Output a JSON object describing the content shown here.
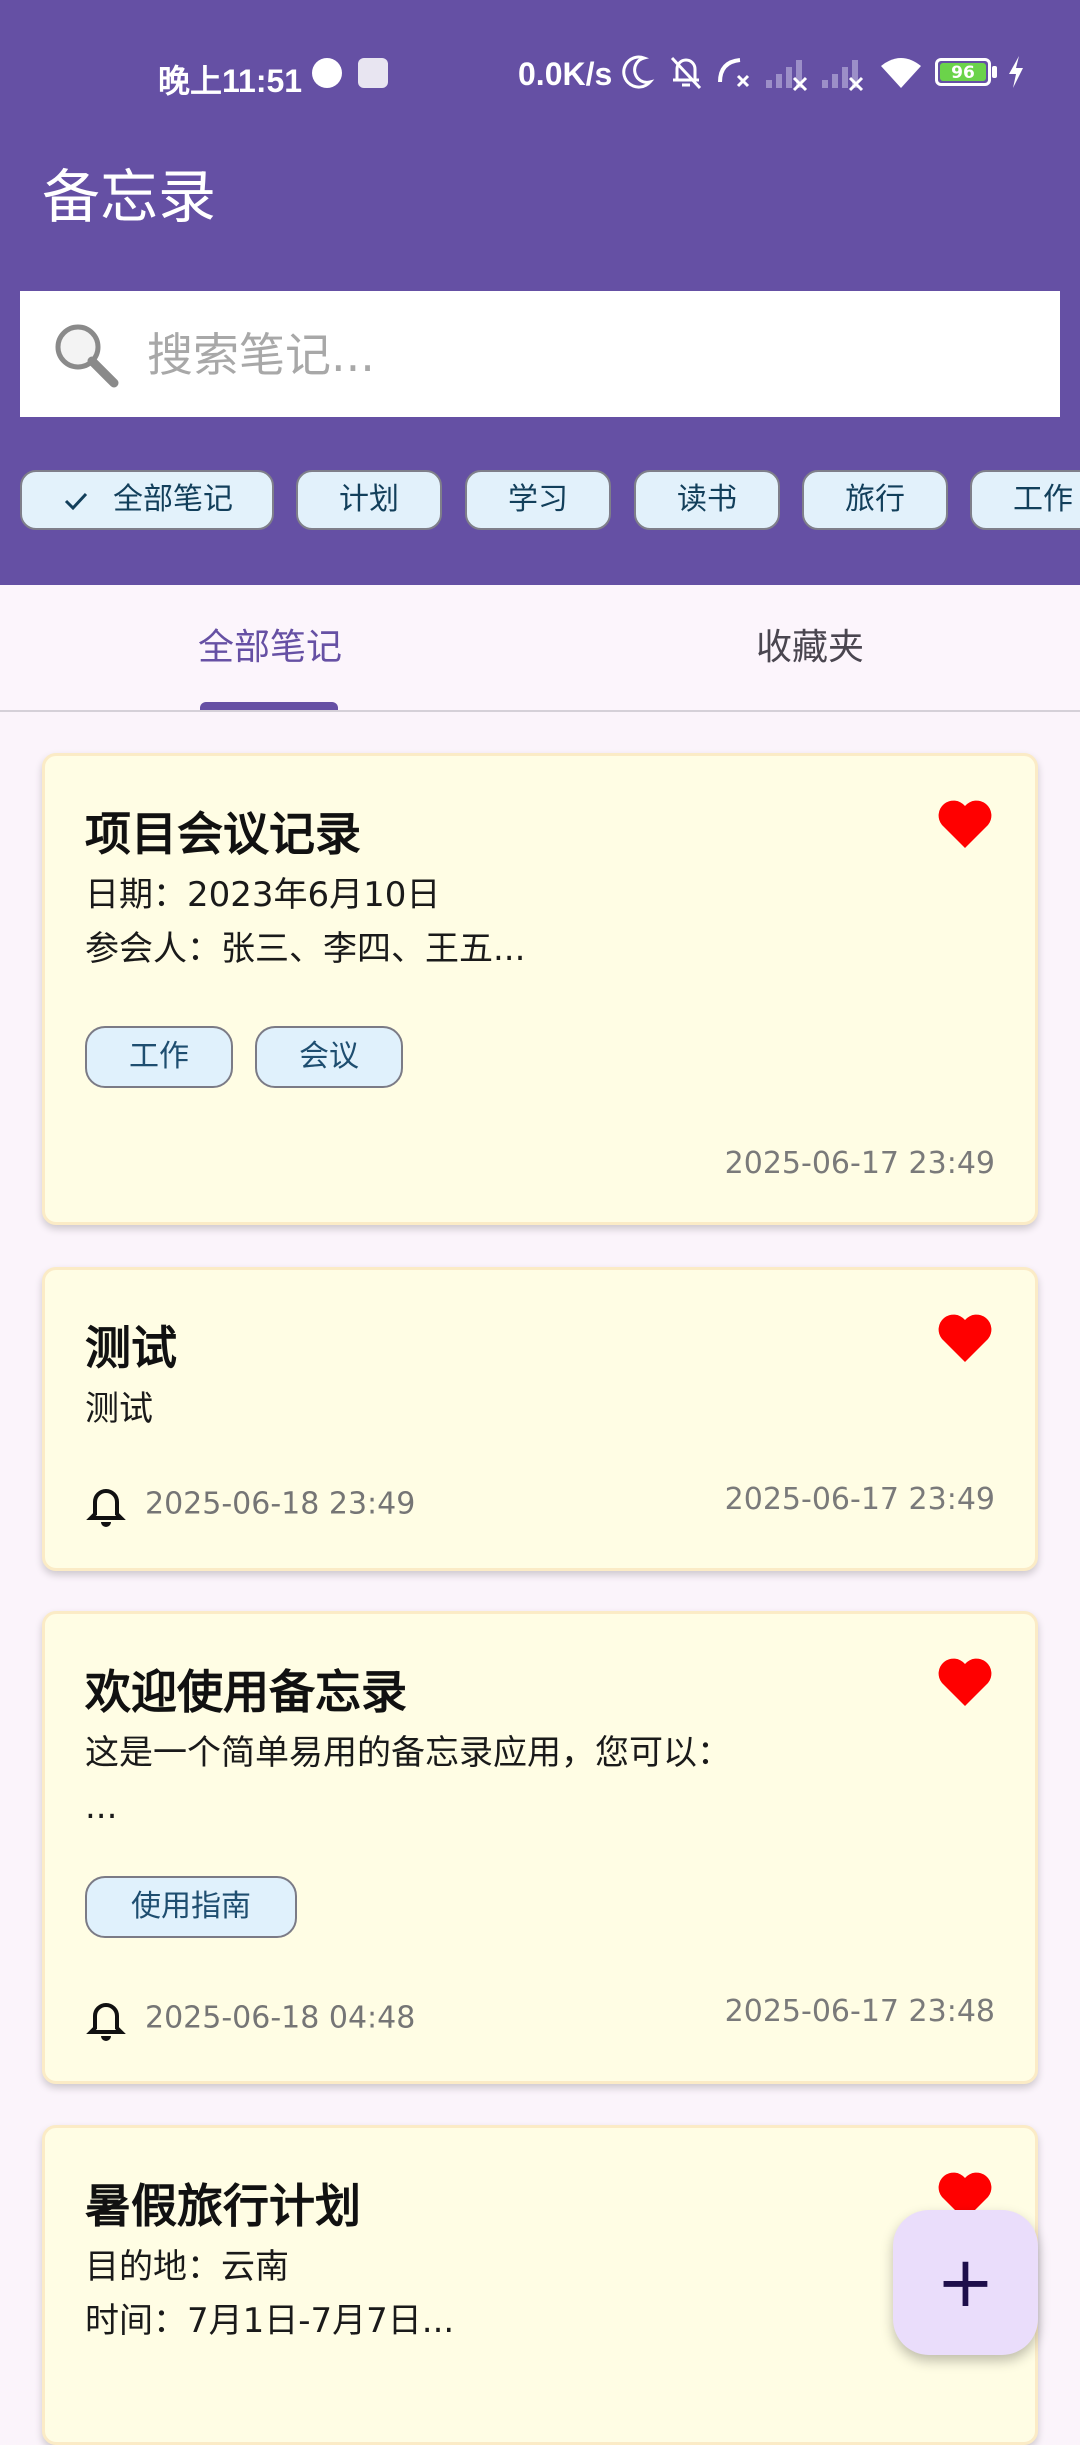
{
  "status_bar": {
    "time": "晚上11:51",
    "net_speed": "0.0K/s",
    "battery": "96",
    "icons": [
      "app-badge-icon",
      "game-icon",
      "moon-icon",
      "bell-off-icon",
      "call-missed-icon",
      "signal-off-icon",
      "signal-off-icon",
      "wifi-icon",
      "battery-icon",
      "charging-icon"
    ]
  },
  "app": {
    "title": "备忘录"
  },
  "search": {
    "placeholder": "搜索笔记..."
  },
  "filters": {
    "chips": [
      {
        "label": "全部笔记",
        "selected": true
      },
      {
        "label": "计划",
        "selected": false
      },
      {
        "label": "学习",
        "selected": false
      },
      {
        "label": "读书",
        "selected": false
      },
      {
        "label": "旅行",
        "selected": false
      },
      {
        "label": "工作",
        "selected": false
      }
    ]
  },
  "tabs": [
    {
      "label": "全部笔记",
      "active": true
    },
    {
      "label": "收藏夹",
      "active": false
    }
  ],
  "notes": [
    {
      "title": "项目会议记录",
      "body": "日期：2023年6月10日\n参会人：张三、李四、王五...",
      "tags": [
        "工作",
        "会议"
      ],
      "reminder": "",
      "date": "2025-06-17 23:49",
      "favorite": true
    },
    {
      "title": "测试",
      "body": "测试",
      "tags": [],
      "reminder": "2025-06-18 23:49",
      "date": "2025-06-17 23:49",
      "favorite": true
    },
    {
      "title": "欢迎使用备忘录",
      "body": "这是一个简单易用的备忘录应用，您可以：\n...",
      "tags": [
        "使用指南"
      ],
      "reminder": "2025-06-18 04:48",
      "date": "2025-06-17 23:48",
      "favorite": true
    },
    {
      "title": "暑假旅行计划",
      "body": "目的地：云南\n时间：7月1日-7月7日...",
      "tags": [],
      "reminder": "",
      "date": "",
      "favorite": true
    }
  ],
  "fab": {
    "label": "+"
  },
  "colors": {
    "primary": "#6550A4",
    "card_bg": "#FFFDE4",
    "heart": "#FF0000",
    "chip_bg": "#E2F1FB",
    "fab_bg": "#EADDFB"
  }
}
